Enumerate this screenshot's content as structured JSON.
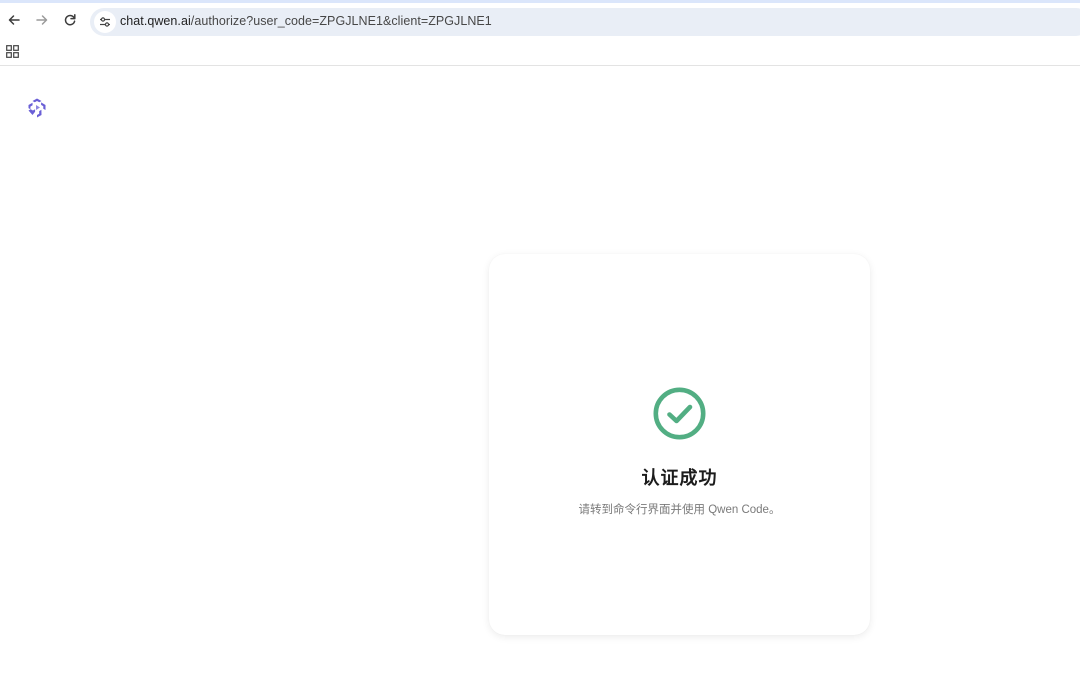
{
  "browser": {
    "url_host": "chat.qwen.ai",
    "url_path": "/authorize?user_code=ZPGJLNE1&client=ZPGJLNE1",
    "icons": {
      "back": "arrow-left-icon",
      "forward": "arrow-right-icon",
      "reload": "reload-icon",
      "site_info": "tune-icon",
      "apps": "apps-grid-icon"
    }
  },
  "page": {
    "logo": "qwen-logo-icon",
    "status_icon": "check-circle-icon",
    "title": "认证成功",
    "message": "请转到命令行界面并使用 Qwen Code。"
  },
  "colors": {
    "success": "#52ae83",
    "brand": "#6a5fd6"
  }
}
